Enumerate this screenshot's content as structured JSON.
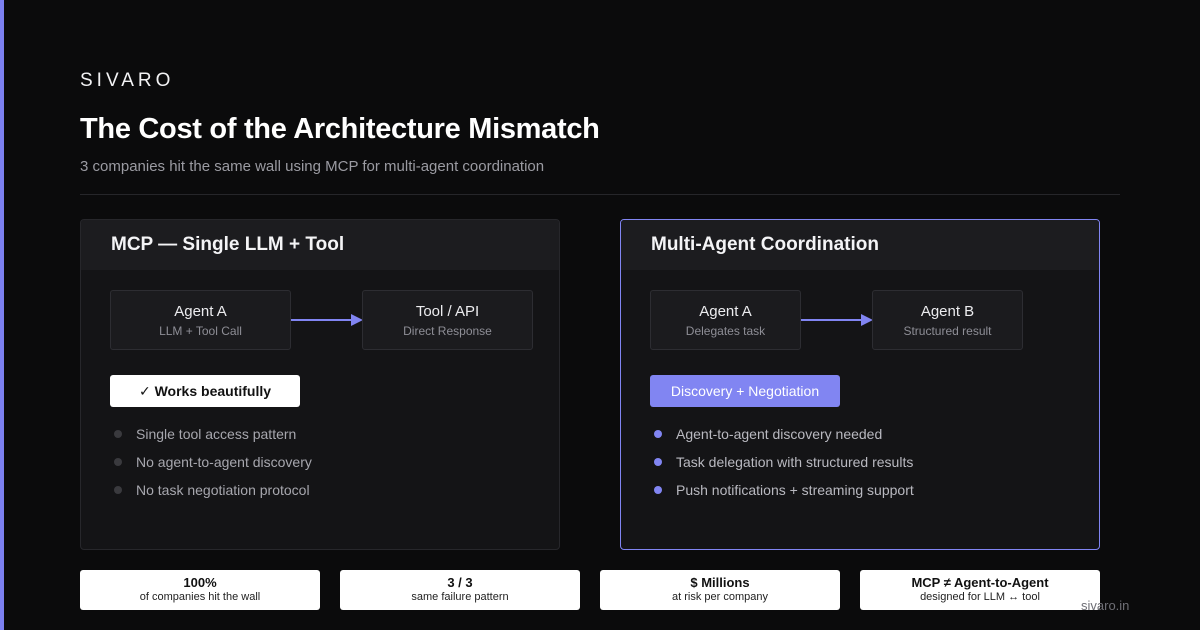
{
  "brand": "SIVARO",
  "title": "The Cost of the Architecture Mismatch",
  "subtitle": "3 companies hit the same wall using MCP for multi-agent coordination",
  "colors": {
    "accent": "#8185f2",
    "background": "#0b0b0c",
    "panel": "#141416"
  },
  "left_panel": {
    "heading": "MCP — Single LLM + Tool",
    "node_a": {
      "title": "Agent A",
      "subtitle": "LLM + Tool Call"
    },
    "node_b": {
      "title": "Tool / API",
      "subtitle": "Direct Response"
    },
    "badge": "✓ Works beautifully",
    "bullets": [
      "Single tool access pattern",
      "No agent-to-agent discovery",
      "No task negotiation protocol"
    ]
  },
  "right_panel": {
    "heading": "Multi-Agent Coordination",
    "node_a": {
      "title": "Agent A",
      "subtitle": "Delegates task"
    },
    "node_b": {
      "title": "Agent B",
      "subtitle": "Structured result"
    },
    "badge": "Discovery + Negotiation",
    "bullets": [
      "Agent-to-agent discovery needed",
      "Task delegation with structured results",
      "Push notifications + streaming support"
    ]
  },
  "stats": [
    {
      "value": "100%",
      "label": "of companies hit the wall"
    },
    {
      "value": "3 / 3",
      "label": "same failure pattern"
    },
    {
      "value": "$ Millions",
      "label": "at risk per company"
    },
    {
      "value": "MCP ≠ Agent-to-Agent",
      "label": "designed for LLM ↔ tool"
    }
  ],
  "footer_url": "sivaro.in"
}
